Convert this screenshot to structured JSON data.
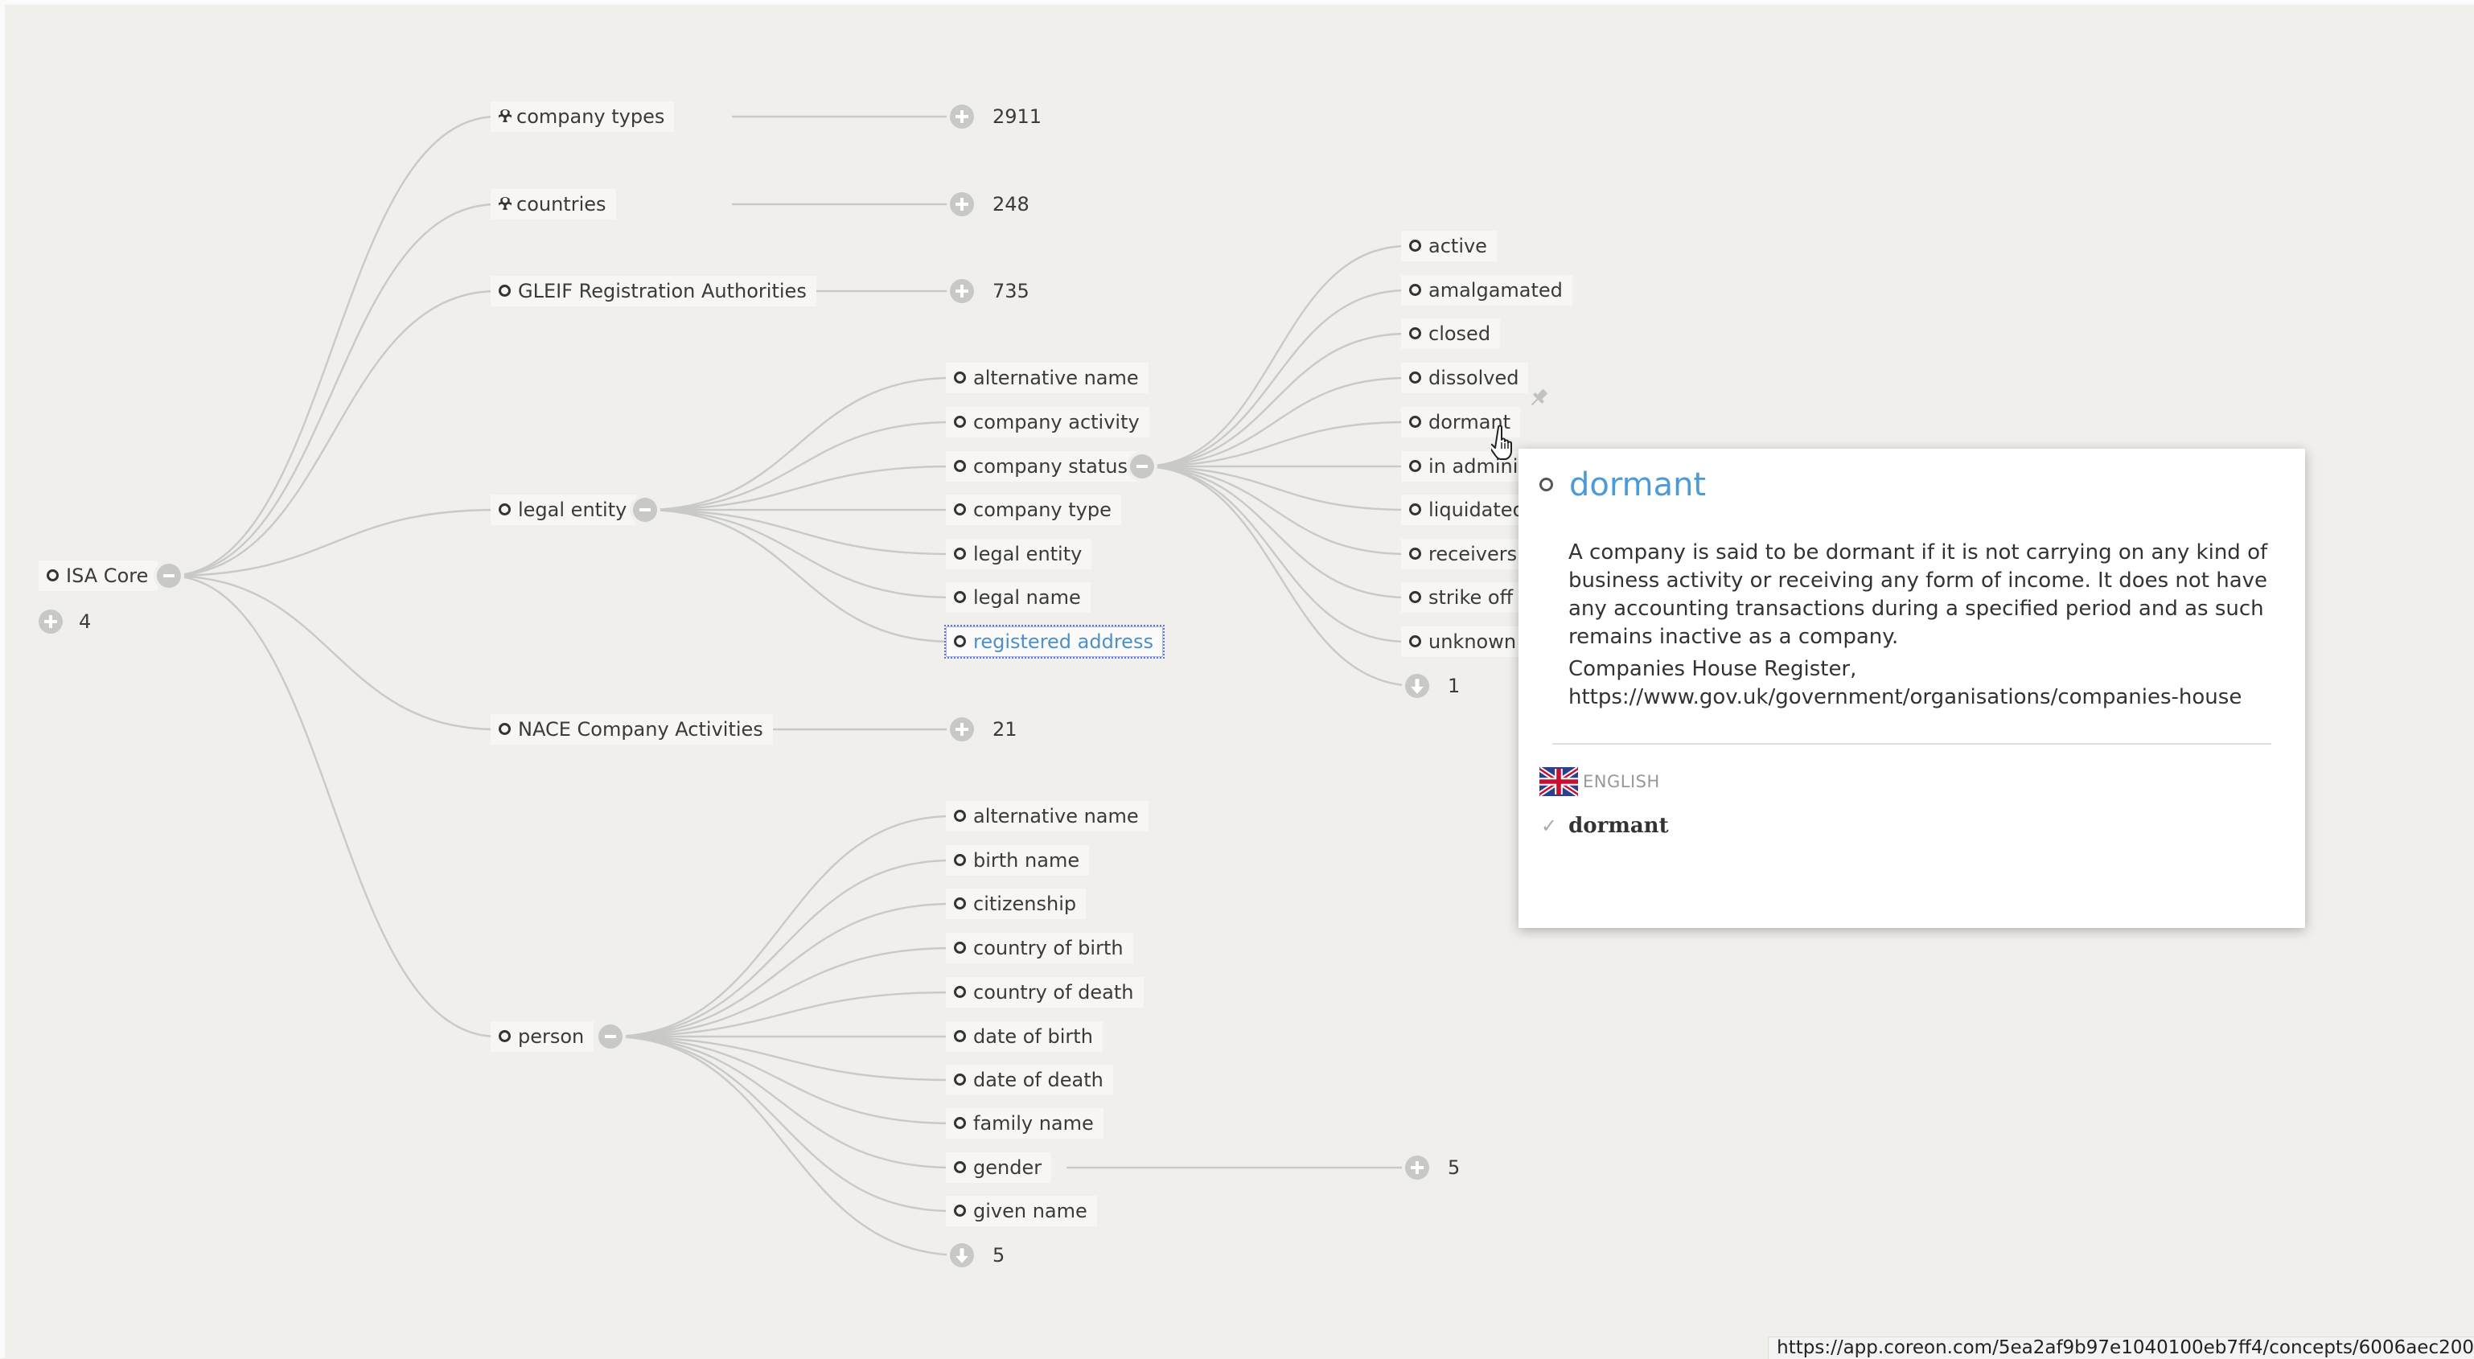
{
  "graph": {
    "root": {
      "label": "ISA Core",
      "more_count": "4"
    },
    "level1": [
      {
        "label": "company types",
        "icon": "concept-group-icon",
        "count": "2911"
      },
      {
        "label": "countries",
        "icon": "concept-group-icon",
        "count": "248"
      },
      {
        "label": "GLEIF Registration Authorities",
        "icon": "concept-dot-icon",
        "count": "735"
      },
      {
        "label": "legal entity",
        "icon": "concept-dot-icon",
        "expanded": true
      },
      {
        "label": "NACE Company Activities",
        "icon": "concept-dot-icon",
        "count": "21"
      },
      {
        "label": "person",
        "icon": "concept-dot-icon",
        "expanded": true
      }
    ],
    "legal_entity_children": [
      {
        "label": "alternative name"
      },
      {
        "label": "company activity"
      },
      {
        "label": "company status",
        "expanded": true
      },
      {
        "label": "company type"
      },
      {
        "label": "legal entity"
      },
      {
        "label": "legal name"
      },
      {
        "label": "registered address",
        "selected": true
      }
    ],
    "company_status_children": [
      {
        "label": "active"
      },
      {
        "label": "amalgamated"
      },
      {
        "label": "closed"
      },
      {
        "label": "dissolved"
      },
      {
        "label": "dormant"
      },
      {
        "label": "in adminis"
      },
      {
        "label": "liquidated"
      },
      {
        "label": "receiversh"
      },
      {
        "label": "strike off"
      },
      {
        "label": "unknown"
      }
    ],
    "company_status_more": "1",
    "person_children": [
      {
        "label": "alternative name"
      },
      {
        "label": "birth name"
      },
      {
        "label": "citizenship"
      },
      {
        "label": "country of birth"
      },
      {
        "label": "country of death"
      },
      {
        "label": "date of birth"
      },
      {
        "label": "date of death"
      },
      {
        "label": "family name"
      },
      {
        "label": "gender",
        "count": "5"
      },
      {
        "label": "given name"
      }
    ],
    "person_more": "5"
  },
  "popup": {
    "title": "dormant",
    "definition": "A company is said to be dormant if it is not carrying on any kind of business activity or receiving any form of income. It does not have any accounting transactions during a specified period and as such remains inactive as a company.",
    "source": "Companies House Register, https://www.gov.uk/government/organisations/companies-house",
    "language": "ENGLISH",
    "language_icon": "uk-flag-icon",
    "term": "dormant",
    "term_icon": "check-icon"
  },
  "status_bar": {
    "url": "https://app.coreon.com/5ea2af9b97e1040100eb7ff4/concepts/6006aec200"
  },
  "colors": {
    "background": "#f0efec",
    "edge": "#c9c9c6",
    "accent": "#4a9bd8",
    "selected_outline": "#5b75d9"
  }
}
